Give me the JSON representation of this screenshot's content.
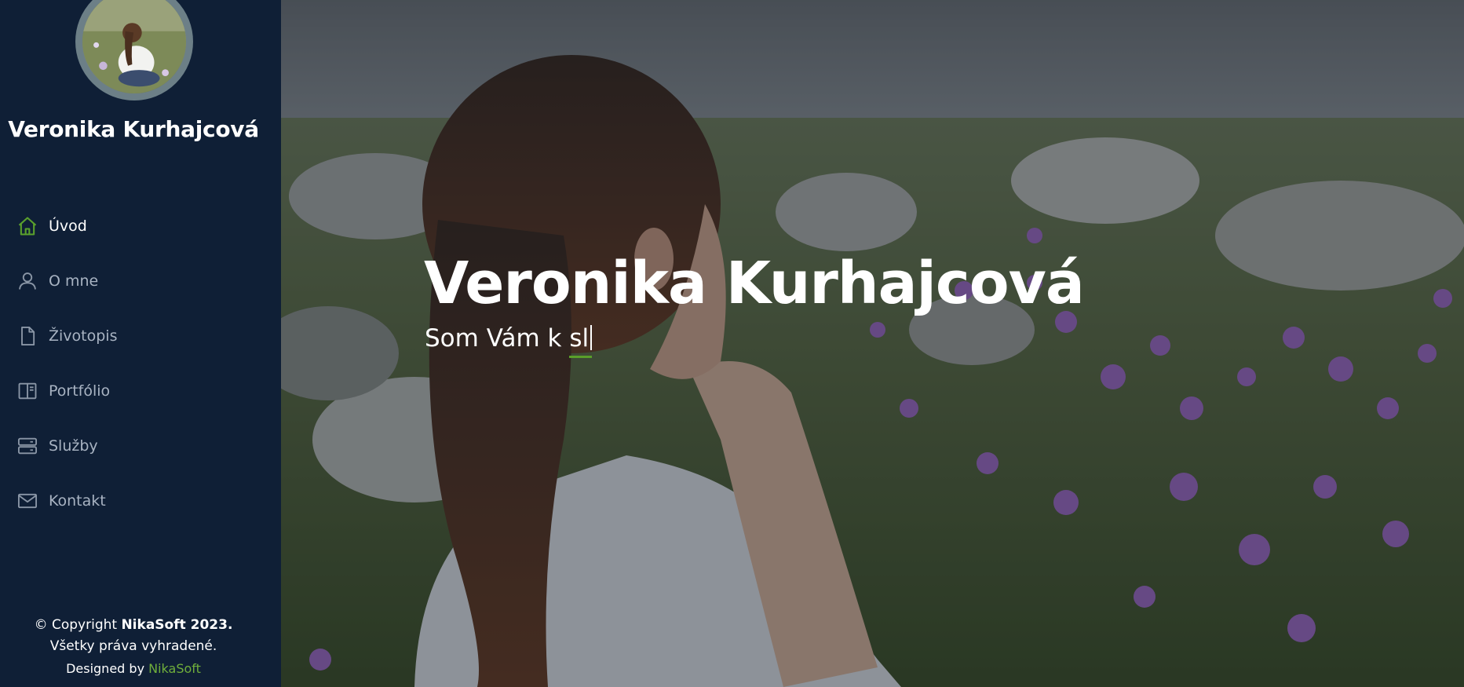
{
  "sidebar": {
    "name": "Veronika Kurhajcová",
    "nav": [
      {
        "label": "Úvod",
        "icon": "home-icon",
        "active": true
      },
      {
        "label": "O mne",
        "icon": "user-icon",
        "active": false
      },
      {
        "label": "Životopis",
        "icon": "file-icon",
        "active": false
      },
      {
        "label": "Portfólio",
        "icon": "book-icon",
        "active": false
      },
      {
        "label": "Služby",
        "icon": "server-icon",
        "active": false
      },
      {
        "label": "Kontakt",
        "icon": "envelope-icon",
        "active": false
      }
    ],
    "footer": {
      "copyright_prefix": "© Copyright ",
      "copyright_brand": "NikaSoft 2023.",
      "rights": "Všetky práva vyhradené.",
      "designed_prefix": "Designed by ",
      "designed_brand": "NikaSoft"
    }
  },
  "hero": {
    "title": "Veronika Kurhajcová",
    "subtitle_static": "Som Vám k ",
    "subtitle_typed": "sl"
  },
  "colors": {
    "sidebar_bg": "#0f1f36",
    "accent": "#6fae3b",
    "nav_inactive": "#a8b3c2"
  }
}
